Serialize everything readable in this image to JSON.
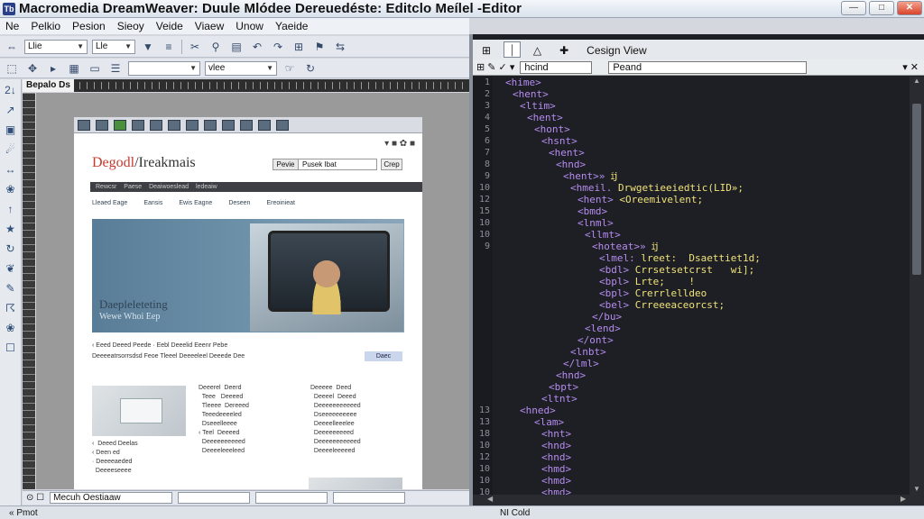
{
  "window": {
    "app_icon": "Tb",
    "title": "Macromedia DreamWeaver: Duule Mlódee Dereuedéste: Editclo Meílel -Editor",
    "controls": [
      "―",
      "□",
      "✕"
    ]
  },
  "menubar": {
    "items": [
      "Ne",
      "Pelkio",
      "Pesion",
      "Sieoy",
      "Veide",
      "Viaew",
      "Unow",
      "Yaeide"
    ]
  },
  "toolbar": {
    "font_select": "Llie",
    "size_select": "Lle",
    "style_field": "vlee",
    "icons": [
      "pointer-icon",
      "play-icon",
      "doc-icon",
      "image-icon",
      "list-icon",
      "scissors-icon",
      "search-icon",
      "undo-icon",
      "redo-icon",
      "tree-icon",
      "pin-icon"
    ]
  },
  "left_tools": [
    "2↓",
    "↗",
    "▣",
    "☄",
    "↔",
    "❀",
    "↑",
    "★",
    "↻",
    "❦",
    "✎",
    "☈",
    "❀",
    "☐"
  ],
  "design_view": {
    "doc_tab": "Bepalo Ds",
    "page": {
      "logo_left": "Degodl",
      "logo_right": "/Ireakmais",
      "search_prefix": "Pevie",
      "search_value": "Pusek  Ibat",
      "search_button": "Crep",
      "nav": "Rewcsr  Paese  Deaiwoeslead ledeaiw",
      "subnav": [
        "Lleaed  Eage",
        "Eansis",
        "Ewis  Eagne",
        "Deseen",
        "Ereoinieat"
      ],
      "hero_title": "Daepleleteting",
      "hero_sub": "Wewe Whoi  Eep",
      "line1": "‹  Eeed  Deeed Peede  · Eebl  Deeelid  Eeenr  Pebe",
      "line2": "Deeeeatrsorrsdsd Feoe  Tleeel  Deeeeleel Deeede  Dee",
      "cta": "Daec",
      "col1": "‹  Deeed Deelas\n‹ Deen ed\n· Deeeeaeded\n  Deeeeseeee",
      "col2": "Deeerel  Deerd\n  Teee   Deeeed\n  Tleeee  Dereeed\n  Teeedeeeeled\n  Dseeelleeee\n‹ Teel  Deeeed\n  Deeeeeeeeeed\n  Deeeeleeeleed",
      "col3": "Deeeee  Deed\n  Deeeel  Deeed\n  Deeeeeeeeeeed\n  Dseeeeeeeeee\n  Deeeelleeelee\n  Deeeeeeeeed\n  Deeeeeeeeeeed\n  Deeeeleeeeed"
    },
    "status_text": "Mecuh Oestiaaw"
  },
  "code_view": {
    "tabs": [
      "⊞",
      "⏐",
      "△",
      "✚"
    ],
    "design_tab": "Cesign View",
    "subbar_left": "hcind",
    "subbar_right": "Peand",
    "gutter": [
      "1",
      "2",
      "3",
      "4",
      "5",
      "6",
      "7",
      "8",
      "9",
      "10",
      "12",
      "15",
      "10",
      "10",
      "9",
      "",
      "",
      "",
      "",
      "",
      "",
      "",
      "",
      "",
      "",
      "",
      "",
      "",
      "13",
      "13",
      "18",
      "10",
      "12",
      "10",
      "10",
      "10",
      "10"
    ],
    "lines": [
      {
        "indent": 0,
        "text": "<hime>"
      },
      {
        "indent": 1,
        "text": "<hent>"
      },
      {
        "indent": 2,
        "text": "<ltim>"
      },
      {
        "indent": 3,
        "text": "<hent>"
      },
      {
        "indent": 4,
        "text": "<hont>"
      },
      {
        "indent": 5,
        "text": "<hsnt>"
      },
      {
        "indent": 6,
        "text": "<hent>"
      },
      {
        "indent": 7,
        "text": "<hnd>"
      },
      {
        "indent": 8,
        "text": "<hent>»",
        "attr": "ĳ"
      },
      {
        "indent": 9,
        "text": "<hmeil.",
        "attr": "Drwgetieeiedtic(LID»;"
      },
      {
        "indent": 10,
        "text": "<hent>",
        "attr": "<Oreemivelent;"
      },
      {
        "indent": 10,
        "text": "<bmd>"
      },
      {
        "indent": 10,
        "text": "<lnml>"
      },
      {
        "indent": 11,
        "text": "<llmt>"
      },
      {
        "indent": 12,
        "text": "<hoteat>»",
        "attr": "ĳ"
      },
      {
        "indent": 13,
        "text": "<lmel:",
        "attr": "lreet:  Dsaettiet1d;"
      },
      {
        "indent": 13,
        "text": "<bdl>",
        "attr": "Crrsetsetcrst   wi];"
      },
      {
        "indent": 13,
        "text": "<bpl>",
        "attr": "Lrte;    !"
      },
      {
        "indent": 13,
        "text": "<bpl>",
        "attr": "Crerrlelldeo"
      },
      {
        "indent": 13,
        "text": "<bel>",
        "attr": "Crreeeaceorcst;"
      },
      {
        "indent": 12,
        "text": "</bu>"
      },
      {
        "indent": 11,
        "text": "<lend>"
      },
      {
        "indent": 10,
        "text": "</ont>"
      },
      {
        "indent": 9,
        "text": "<lnbt>"
      },
      {
        "indent": 8,
        "text": "</lml>"
      },
      {
        "indent": 7,
        "text": "<hnd>"
      },
      {
        "indent": 6,
        "text": "<bpt>"
      },
      {
        "indent": 5,
        "text": "<ltnt>"
      },
      {
        "indent": 2,
        "text": "<hned>"
      },
      {
        "indent": 4,
        "text": "<lam>"
      },
      {
        "indent": 5,
        "text": "<hnt>"
      },
      {
        "indent": 5,
        "text": "<hnd>"
      },
      {
        "indent": 5,
        "text": "<hnd>"
      },
      {
        "indent": 5,
        "text": "<hmd>"
      },
      {
        "indent": 5,
        "text": "<hmd>"
      },
      {
        "indent": 5,
        "text": "<hmd>"
      }
    ]
  },
  "statusbar": {
    "left": "«   Pmot",
    "right": "NI Cold"
  }
}
